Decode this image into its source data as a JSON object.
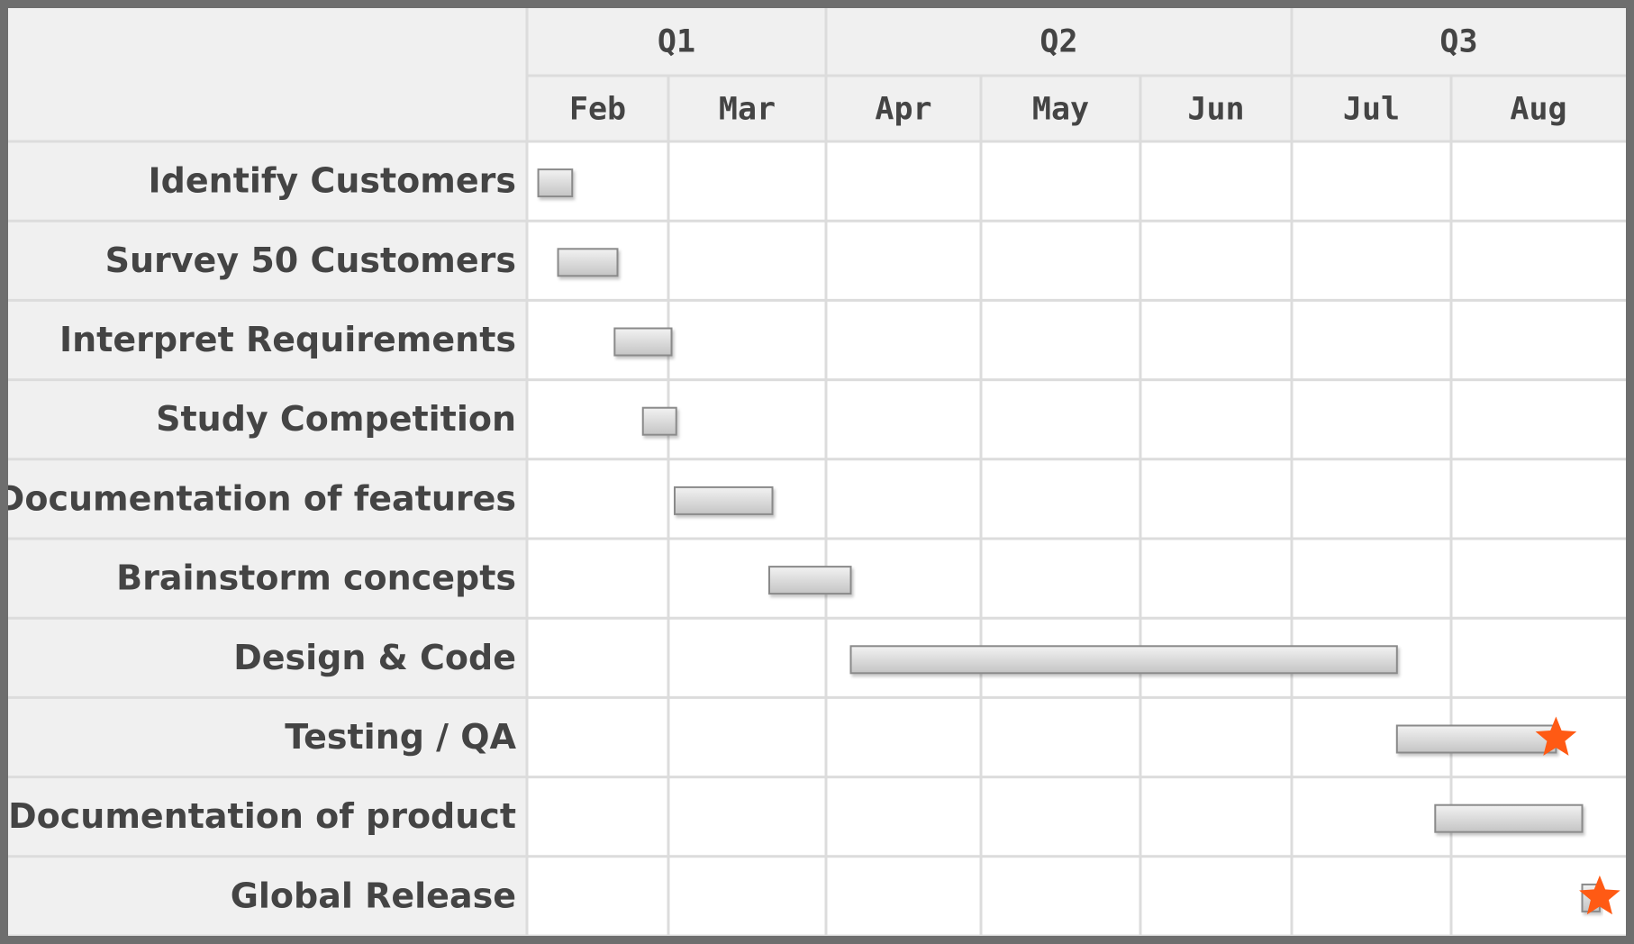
{
  "chart_data": {
    "type": "gantt",
    "quarters": [
      {
        "label": "Q1",
        "start": 0,
        "end": 2
      },
      {
        "label": "Q2",
        "start": 2,
        "end": 5
      },
      {
        "label": "Q3",
        "start": 5,
        "end": 7
      }
    ],
    "months": [
      "Feb",
      "Mar",
      "Apr",
      "May",
      "Jun",
      "Jul",
      "Aug"
    ],
    "tasks": [
      {
        "name": "Identify Customers",
        "start": 0.08,
        "end": 0.32,
        "milestone": false
      },
      {
        "name": "Survey 50 Customers",
        "start": 0.22,
        "end": 0.64,
        "milestone": false
      },
      {
        "name": "Interpret Requirements",
        "start": 0.62,
        "end": 1.02,
        "milestone": false
      },
      {
        "name": "Study Competition",
        "start": 0.82,
        "end": 1.05,
        "milestone": false
      },
      {
        "name": "Documentation of features",
        "start": 1.04,
        "end": 1.66,
        "milestone": false
      },
      {
        "name": "Brainstorm concepts",
        "start": 1.64,
        "end": 2.16,
        "milestone": false
      },
      {
        "name": "Design & Code",
        "start": 2.16,
        "end": 5.66,
        "milestone": false
      },
      {
        "name": "Testing / QA",
        "start": 5.66,
        "end": 6.6,
        "milestone": true
      },
      {
        "name": "Documentation of product",
        "start": 5.9,
        "end": 6.75,
        "milestone": false
      },
      {
        "name": "Global Release",
        "start": 6.75,
        "end": 6.85,
        "milestone": true
      }
    ],
    "colors": {
      "label_background": "#f0f0f0",
      "grid_line": "#dcdcdc",
      "bar_top": "#f2f2f2",
      "bar_bottom": "#c4c4c4",
      "bar_border": "#8a8a8a",
      "milestone": "#ff5a14",
      "text": "#444444"
    },
    "grid": true,
    "legend": "none"
  }
}
